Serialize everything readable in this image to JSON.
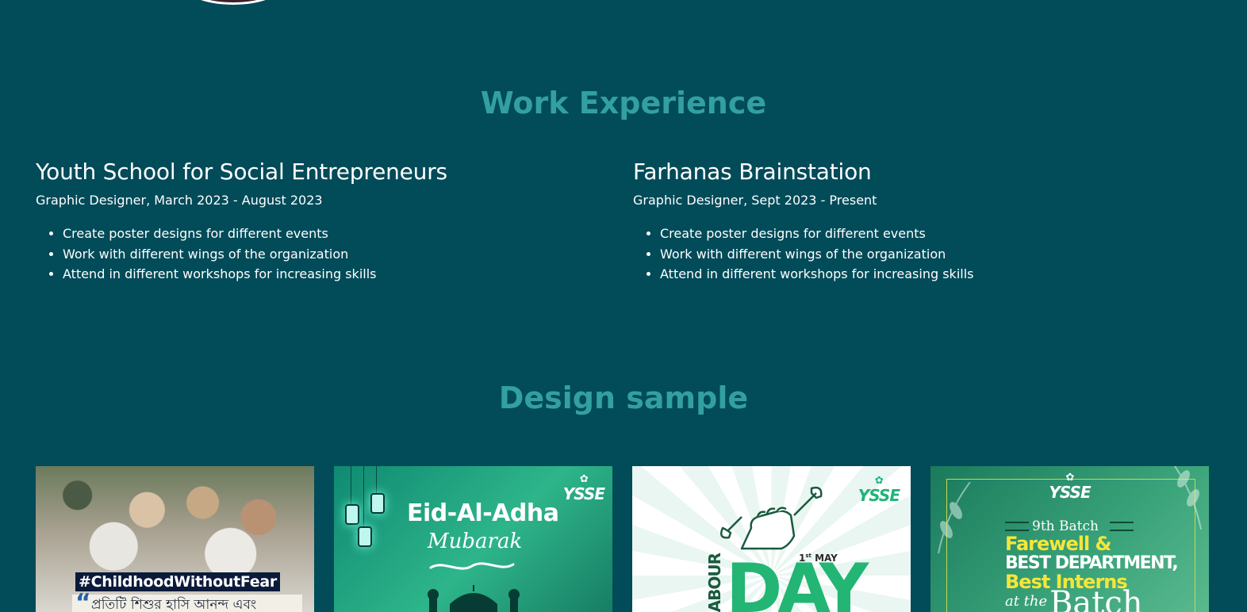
{
  "sections": {
    "work_title": "Work Experience",
    "design_title": "Design sample"
  },
  "jobs": [
    {
      "company": "Youth School for Social Entrepreneurs",
      "role": "Graphic Designer, March 2023 - August 2023",
      "duties": [
        "Create poster designs for different events",
        "Work with different wings of the organization",
        "Attend in different workshops for increasing skills"
      ]
    },
    {
      "company": "Farhanas Brainstation",
      "role": "Graphic Designer, Sept 2023 - Present",
      "duties": [
        "Create poster designs for different events",
        "Work with different wings of the organization",
        "Attend in different workshops for increasing skills"
      ]
    }
  ],
  "samples": [
    {
      "hashtag": "#ChildhoodWithoutFear",
      "quote_mark": "“",
      "bangla": "প্রতিটি শিশুর হাসি আনন্দ এবং"
    },
    {
      "logo": "YSSE",
      "title": "Eid-Al-Adha",
      "subtitle": "Mubarak"
    },
    {
      "logo": "YSSE",
      "date_day": "1",
      "date_suffix": "st",
      "date_month": "MAY",
      "vertical": "LABOUR",
      "big": "DAY"
    },
    {
      "logo": "YSSE",
      "batch": "9th Batch",
      "line1": "Farewell &",
      "line2": "BEST DEPARTMENT,",
      "line3": "Best Interns",
      "line4": "at the",
      "line5": "Batch"
    }
  ],
  "colors": {
    "background": "#024b59",
    "heading_accent": "#33a0a0",
    "text": "#ffffff"
  }
}
